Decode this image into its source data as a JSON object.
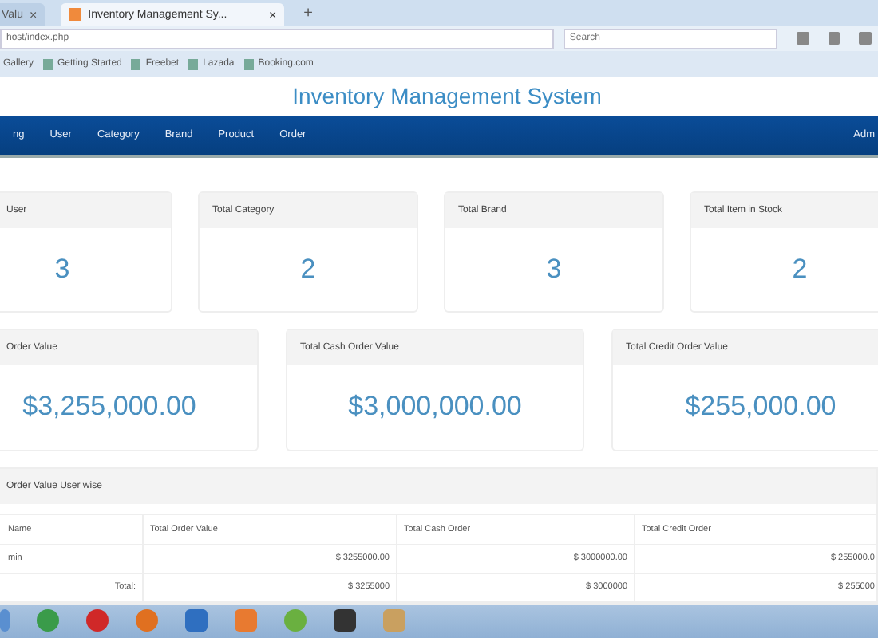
{
  "browser": {
    "tabs": [
      {
        "label": "Valu",
        "selected": false,
        "close": "×"
      },
      {
        "label": "Inventory Management Sy...",
        "selected": true,
        "close": "×"
      }
    ],
    "new_tab": "+",
    "address": "host/index.php",
    "search": {
      "placeholder": "Search"
    },
    "bookmarks": [
      "Gallery",
      "Getting Started",
      "Freebet",
      "Lazada",
      "Booking.com"
    ]
  },
  "header": {
    "title": "Inventory Management System"
  },
  "nav": {
    "items": [
      "ng",
      "User",
      "Category",
      "Brand",
      "Product",
      "Order"
    ],
    "right": "Adm"
  },
  "stat_cards": [
    {
      "title": "User",
      "value": "3"
    },
    {
      "title": "Total Category",
      "value": "2"
    },
    {
      "title": "Total Brand",
      "value": "3"
    },
    {
      "title": "Total Item in Stock",
      "value": "2"
    }
  ],
  "value_cards": [
    {
      "title": "Order Value",
      "value": "$3,255,000.00"
    },
    {
      "title": "Total Cash Order Value",
      "value": "$3,000,000.00"
    },
    {
      "title": "Total Credit Order Value",
      "value": "$255,000.00"
    }
  ],
  "section": {
    "title": "Order Value User wise"
  },
  "table": {
    "columns": [
      "Name",
      "Total Order Value",
      "Total Cash Order",
      "Total Credit Order"
    ],
    "rows": [
      [
        "min",
        "$ 3255000.00",
        "$ 3000000.00",
        "$ 255000.0"
      ],
      [
        "Total:",
        "$ 3255000",
        "$ 3000000",
        "$ 255000"
      ]
    ]
  }
}
